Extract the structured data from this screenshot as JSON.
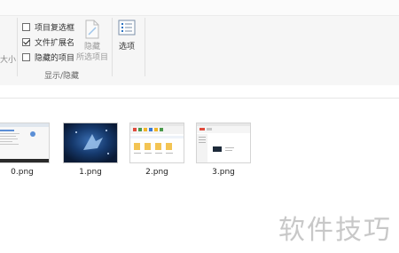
{
  "ribbon": {
    "partial_label": "大小",
    "checkboxes": [
      {
        "label": "项目复选框",
        "checked": false
      },
      {
        "label": "文件扩展名",
        "checked": true
      },
      {
        "label": "隐藏的项目",
        "checked": false
      }
    ],
    "hide_selected": {
      "line1": "隐藏",
      "line2": "所选项目"
    },
    "options_label": "选项",
    "group_label": "显示/隐藏"
  },
  "files": [
    {
      "name": "0.png",
      "icon": "screenshot-thumbnail"
    },
    {
      "name": "1.png",
      "icon": "dark-blue-image-thumbnail"
    },
    {
      "name": "2.png",
      "icon": "app-window-thumbnail"
    },
    {
      "name": "3.png",
      "icon": "app-window-thumbnail"
    }
  ],
  "watermark": "软件技巧"
}
